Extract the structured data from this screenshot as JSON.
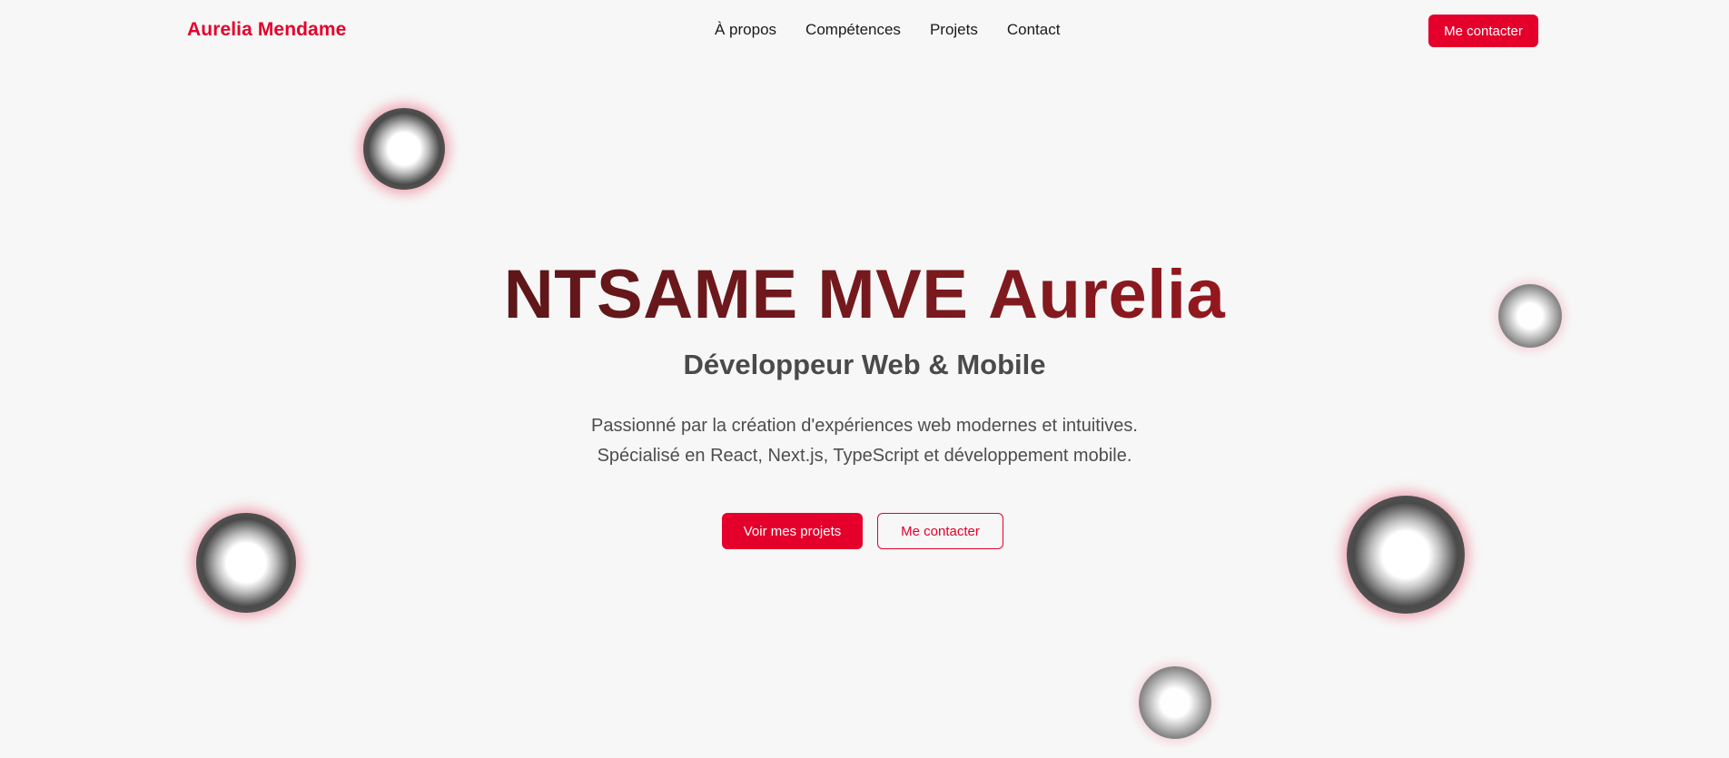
{
  "nav": {
    "brand": "Aurelia Mendame",
    "links": [
      "À propos",
      "Compétences",
      "Projets",
      "Contact"
    ],
    "cta_label": "Me contacter"
  },
  "hero": {
    "title_words": [
      "NTSAME",
      "MVE",
      "Aurelia"
    ],
    "subtitle": "Développeur Web & Mobile",
    "description_lines": [
      "Passionné par la création d'expériences web modernes et intuitives.",
      "Spécialisé en React, Next.js, TypeScript et développement mobile."
    ],
    "primary_button": "Voir mes projets",
    "secondary_button": "Me contacter"
  },
  "colors": {
    "accent": "#e4002b",
    "background": "#f7f7f7",
    "title_gradient_start": "#3f1212",
    "title_gradient_end": "#c4121f"
  }
}
